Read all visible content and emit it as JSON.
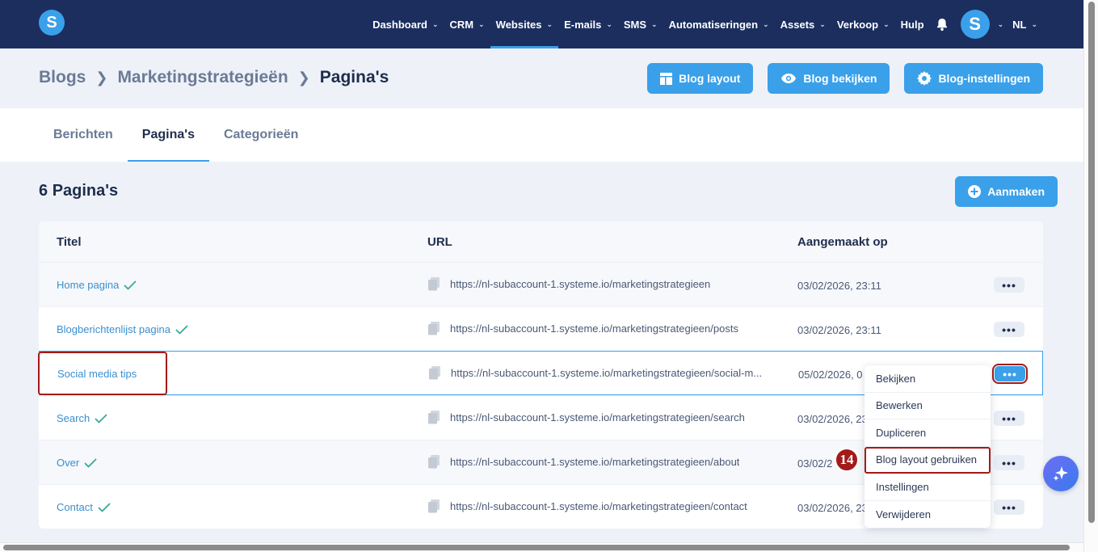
{
  "nav": {
    "logo": "S",
    "items": [
      {
        "label": "Dashboard",
        "chevron": true
      },
      {
        "label": "CRM",
        "chevron": true
      },
      {
        "label": "Websites",
        "chevron": true,
        "active": true
      },
      {
        "label": "E-mails",
        "chevron": true
      },
      {
        "label": "SMS",
        "chevron": true
      },
      {
        "label": "Automatiseringen",
        "chevron": true
      },
      {
        "label": "Assets",
        "chevron": true
      },
      {
        "label": "Verkoop",
        "chevron": true
      },
      {
        "label": "Hulp",
        "chevron": false
      }
    ],
    "avatar": "S",
    "language": "NL"
  },
  "breadcrumb": {
    "items": [
      "Blogs",
      "Marketingstrategieën"
    ],
    "current": "Pagina's"
  },
  "header_buttons": {
    "layout": "Blog layout",
    "view": "Blog bekijken",
    "settings": "Blog-instellingen"
  },
  "tabs": [
    {
      "label": "Berichten",
      "active": false
    },
    {
      "label": "Pagina's",
      "active": true
    },
    {
      "label": "Categorieën",
      "active": false
    }
  ],
  "section": {
    "count": "6",
    "title": "Pagina's",
    "create": "Aanmaken"
  },
  "table": {
    "headers": {
      "title": "Titel",
      "url": "URL",
      "date": "Aangemaakt op"
    },
    "rows": [
      {
        "title": "Home pagina",
        "check": true,
        "url": "https://nl-subaccount-1.systeme.io/marketingstrategieen",
        "date": "03/02/2026, 23:11"
      },
      {
        "title": "Blogberichtenlijst pagina",
        "check": true,
        "url": "https://nl-subaccount-1.systeme.io/marketingstrategieen/posts",
        "date": "03/02/2026, 23:11"
      },
      {
        "title": "Social media tips",
        "check": false,
        "url": "https://nl-subaccount-1.systeme.io/marketingstrategieen/social-m...",
        "date": "05/02/2026, 0"
      },
      {
        "title": "Search",
        "check": true,
        "url": "https://nl-subaccount-1.systeme.io/marketingstrategieen/search",
        "date": "03/02/2026, 23"
      },
      {
        "title": "Over",
        "check": true,
        "url": "https://nl-subaccount-1.systeme.io/marketingstrategieen/about",
        "date": "03/02/2"
      },
      {
        "title": "Contact",
        "check": true,
        "url": "https://nl-subaccount-1.systeme.io/marketingstrategieen/contact",
        "date": "03/02/2026, 23"
      }
    ]
  },
  "dropdown": {
    "items": [
      "Bekijken",
      "Bewerken",
      "Dupliceren",
      "Blog layout gebruiken",
      "Instellingen",
      "Verwijderen"
    ]
  },
  "step_badge": "14",
  "colors": {
    "navbar": "#1b2e5e",
    "accent": "#3aa0ea",
    "highlight": "#a41a1a"
  }
}
